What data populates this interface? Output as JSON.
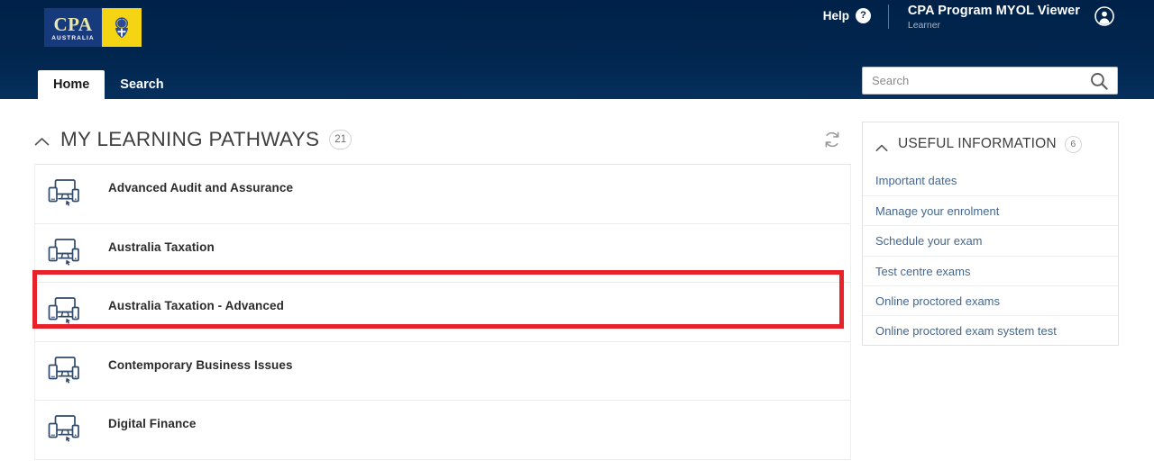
{
  "header": {
    "logo": {
      "brand_line1": "CPA",
      "brand_line2": "AUSTRALIA",
      "left_bg": "#173a7d",
      "right_bg": "#f5d413",
      "crest_icon": "cpa-crest-icon"
    },
    "help_label": "Help",
    "help_icon_glyph": "?",
    "app_title": "CPA Program MYOL Viewer",
    "app_subtitle": "Learner",
    "avatar_icon": "user-avatar-icon",
    "background_color": "#00234f",
    "tabs": [
      {
        "label": "Home",
        "active": true
      },
      {
        "label": "Search",
        "active": false
      }
    ],
    "search": {
      "placeholder": "Search",
      "value": "",
      "icon": "search-icon"
    }
  },
  "left_panel": {
    "title": "MY LEARNING PATHWAYS",
    "count": "21",
    "collapse_icon": "chevron-up-icon",
    "refresh_icon": "refresh-icon",
    "items": [
      {
        "label": "Advanced Audit and Assurance",
        "icon": "multi-device-icon",
        "highlighted": true
      },
      {
        "label": "Australia Taxation",
        "icon": "multi-device-icon",
        "highlighted": false
      },
      {
        "label": "Australia Taxation - Advanced",
        "icon": "multi-device-icon",
        "highlighted": false
      },
      {
        "label": "Contemporary Business Issues",
        "icon": "multi-device-icon",
        "highlighted": false
      },
      {
        "label": "Digital Finance",
        "icon": "multi-device-icon",
        "highlighted": false
      }
    ],
    "highlight_color": "#e8222a"
  },
  "right_panel": {
    "title": "USEFUL INFORMATION",
    "count": "6",
    "collapse_icon": "chevron-up-icon",
    "links": [
      {
        "label": "Important dates"
      },
      {
        "label": "Manage your enrolment"
      },
      {
        "label": "Schedule your exam"
      },
      {
        "label": "Test centre exams"
      },
      {
        "label": "Online proctored exams"
      },
      {
        "label": "Online proctored exam system test"
      }
    ],
    "link_color": "#44678f"
  }
}
